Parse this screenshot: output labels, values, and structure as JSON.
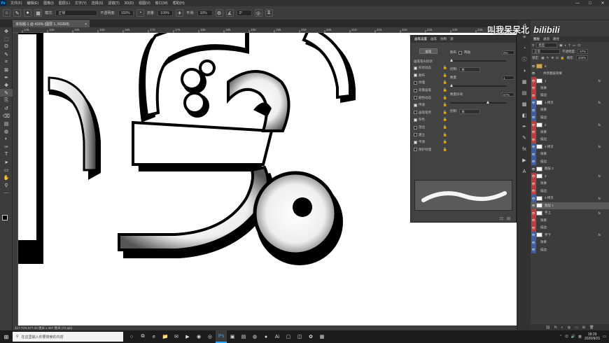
{
  "menubar": {
    "app_icon": "Ps",
    "items": [
      "文件(F)",
      "编辑(E)",
      "图像(I)",
      "图层(L)",
      "文字(Y)",
      "选择(S)",
      "滤镜(T)",
      "3D(D)",
      "视图(V)",
      "窗口(W)",
      "帮助(H)"
    ],
    "window_controls": [
      "—",
      "□",
      "✕"
    ]
  },
  "options_bar": {
    "mode_label": "模式:",
    "mode_value": "正常",
    "opacity_label": "不透明度:",
    "opacity_value": "100%",
    "flow_label": "流量:",
    "flow_value": "100%",
    "smoothing_label": "平滑:",
    "smoothing_value": "10%",
    "angle_value": "0°"
  },
  "document_tab": {
    "label": "未标题-1 @ 416% (图层 1, RGB/8)",
    "close": "×"
  },
  "toolbar": {
    "tools": [
      "move-icon",
      "marquee-icon",
      "lasso-icon",
      "quick-select-icon",
      "crop-icon",
      "frame-icon",
      "eyedropper-icon",
      "healing-icon",
      "brush-icon",
      "stamp-icon",
      "history-brush-icon",
      "eraser-icon",
      "gradient-icon",
      "blur-icon",
      "dodge-icon",
      "pen-icon",
      "type-icon",
      "path-select-icon",
      "rectangle-icon",
      "hand-icon",
      "zoom-icon",
      "more-icon"
    ],
    "glyphs": [
      "✥",
      "⬚",
      "ʘ",
      "✎",
      "⌗",
      "⊠",
      "✒",
      "✚",
      "✎",
      "⎘",
      "↺",
      "⌫",
      "▤",
      "◍",
      "◐",
      "✑",
      "T",
      "➤",
      "▭",
      "✋",
      "⚲",
      "⋯"
    ]
  },
  "rulers": {
    "top_ticks": [
      "145",
      "150",
      "155",
      "160",
      "165",
      "170",
      "175",
      "180",
      "185",
      "190",
      "195",
      "200",
      "205",
      "210",
      "215",
      "220",
      "225",
      "230",
      "235",
      "240"
    ]
  },
  "status_bar": {
    "text": "417.72%   577.33 厘米 x 387 厘米 (72 ppi)"
  },
  "style_dialog": {
    "tabs": [
      "画笔设置",
      "画笔",
      "仿制",
      "源"
    ],
    "reset_button": "画笔",
    "brush_tip_label": "画笔笔尖形状",
    "effects": [
      {
        "label": "形状动态",
        "checked": true
      },
      {
        "label": "散布",
        "checked": true
      },
      {
        "label": "纹理",
        "checked": false
      },
      {
        "label": "双重画笔",
        "checked": false
      },
      {
        "label": "颜色动态",
        "checked": false
      },
      {
        "label": "传递",
        "checked": true
      },
      {
        "label": "画笔笔势",
        "checked": false
      },
      {
        "label": "杂色",
        "checked": true
      },
      {
        "label": "湿边",
        "checked": false
      },
      {
        "label": "建立",
        "checked": false
      },
      {
        "label": "平滑",
        "checked": true
      },
      {
        "label": "保护纹理",
        "checked": false
      }
    ],
    "scatter_label": "散布",
    "both_axes_label": "两轴",
    "scatter_value": "0%",
    "control_label": "控制:",
    "control_value": "关",
    "count_label": "数量",
    "count_value": "1",
    "count_jitter_label": "数量抖动",
    "count_jitter_value": "67%",
    "control2_label": "控制:",
    "control2_value": "关",
    "footer_icons": [
      "⊡",
      "⊞"
    ],
    "scatter_level": 0.0,
    "count_jitter_level": 0.67
  },
  "side_dock": {
    "icons": [
      "history-icon",
      "properties-icon",
      "adjust-icon",
      "info-icon",
      "color-icon",
      "swatches-icon",
      "gradient-panel-icon",
      "pattern-icon",
      "channels-icon",
      "paths-icon",
      "brushes-icon",
      "styles-icon",
      "actions-icon",
      "glyphs-icon"
    ],
    "glyphs": [
      "↺",
      "≡",
      "◔",
      "ⓘ",
      "◑",
      "▦",
      "▤",
      "▩",
      "◧",
      "✒",
      "✎",
      "fx",
      "▶",
      "A"
    ]
  },
  "watermark": {
    "text": "叫我呆呆北",
    "logo": "bilibili"
  },
  "layers_panel": {
    "tabs": [
      "图层",
      "通道",
      "路径"
    ],
    "filter_kind": "类型",
    "blend_mode": "正常",
    "opacity_label": "不透明度:",
    "opacity_value": "67%",
    "lock_label": "锁定:",
    "fill_label": "填充:",
    "fill_value": "100%",
    "layers": [
      {
        "name": "6",
        "kind": "group",
        "tag": "",
        "fx": ""
      },
      {
        "name": "共享图层效果",
        "kind": "sub",
        "tag": "",
        "fx": ""
      },
      {
        "name": "1",
        "kind": "layer",
        "tag": "#c23b3b",
        "fx": "fx"
      },
      {
        "name": "效果",
        "kind": "effect",
        "tag": "#c23b3b",
        "fx": ""
      },
      {
        "name": "描边",
        "kind": "effect",
        "tag": "#c23b3b",
        "fx": ""
      },
      {
        "name": "1 拷贝",
        "kind": "layer",
        "tag": "#3b5ea8",
        "fx": "fx"
      },
      {
        "name": "效果",
        "kind": "effect",
        "tag": "#3b5ea8",
        "fx": ""
      },
      {
        "name": "描边",
        "kind": "effect",
        "tag": "#3b5ea8",
        "fx": ""
      },
      {
        "name": "2",
        "kind": "layer",
        "tag": "#c23b3b",
        "fx": "fx"
      },
      {
        "name": "效果",
        "kind": "effect",
        "tag": "#c23b3b",
        "fx": ""
      },
      {
        "name": "描边",
        "kind": "effect",
        "tag": "#c23b3b",
        "fx": ""
      },
      {
        "name": "2 拷贝",
        "kind": "layer",
        "tag": "#3b5ea8",
        "fx": "fx"
      },
      {
        "name": "效果",
        "kind": "effect",
        "tag": "#3b5ea8",
        "fx": ""
      },
      {
        "name": "描边",
        "kind": "effect",
        "tag": "#3b5ea8",
        "fx": ""
      },
      {
        "name": "图层 2",
        "kind": "layer",
        "tag": "",
        "fx": ""
      },
      {
        "name": "3",
        "kind": "layer",
        "tag": "#c23b3b",
        "fx": "fx"
      },
      {
        "name": "效果",
        "kind": "effect",
        "tag": "#c23b3b",
        "fx": ""
      },
      {
        "name": "描边",
        "kind": "effect",
        "tag": "#c23b3b",
        "fx": ""
      },
      {
        "name": "3 拷贝",
        "kind": "layer",
        "tag": "#3b5ea8",
        "fx": "fx"
      },
      {
        "name": "图层 1",
        "kind": "layer",
        "tag": "",
        "fx": "",
        "selected": true
      },
      {
        "name": "字上",
        "kind": "layer",
        "tag": "#c23b3b",
        "fx": "fx"
      },
      {
        "name": "效果",
        "kind": "effect",
        "tag": "#c23b3b",
        "fx": ""
      },
      {
        "name": "描边",
        "kind": "effect",
        "tag": "#c23b3b",
        "fx": ""
      },
      {
        "name": "字下",
        "kind": "layer",
        "tag": "#3b5ea8",
        "fx": "fx"
      },
      {
        "name": "效果",
        "kind": "effect",
        "tag": "#3b5ea8",
        "fx": ""
      },
      {
        "name": "描边",
        "kind": "effect",
        "tag": "#3b5ea8",
        "fx": ""
      }
    ],
    "footer_icons": [
      "⛓",
      "fx",
      "◐",
      "◍",
      "▭",
      "⊞",
      "🗑"
    ]
  },
  "taskbar": {
    "start": "⊞",
    "search_placeholder": "在这里输入你要搜索的内容",
    "apps": [
      "○",
      "⧉",
      "e",
      "📁",
      "✉",
      "▶",
      "◉",
      "◎",
      "Ps",
      "▣",
      "▤",
      "◍",
      "●",
      "Ai",
      "▢",
      "◫",
      "✿",
      "▦"
    ],
    "tray_text": "英",
    "time": "18:29",
    "date": "2020/9/21"
  }
}
